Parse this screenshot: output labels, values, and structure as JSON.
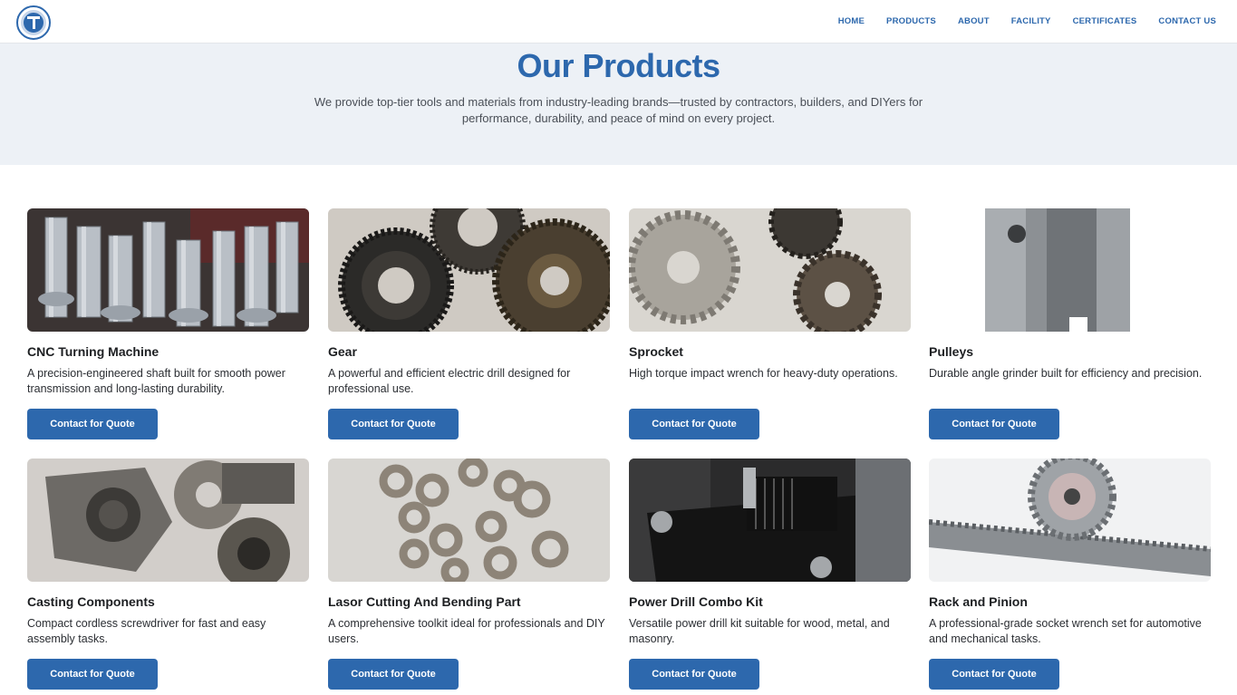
{
  "nav": {
    "items": [
      "HOME",
      "PRODUCTS",
      "ABOUT",
      "FACILITY",
      "CERTIFICATES",
      "CONTACT US"
    ]
  },
  "hero": {
    "title": "Our Products",
    "subtitle": "We provide top-tier tools and materials from industry-leading brands—trusted by contractors, builders, and DIYers for performance, durability, and peace of mind on every project."
  },
  "products": [
    {
      "name": "CNC Turning Machine",
      "description": "A precision-engineered shaft built for smooth power transmission and long-lasting durability.",
      "button": "Contact for Quote"
    },
    {
      "name": "Gear",
      "description": "A powerful and efficient electric drill designed for professional use.",
      "button": "Contact for Quote"
    },
    {
      "name": "Sprocket",
      "description": "High torque impact wrench for heavy-duty operations.",
      "button": "Contact for Quote"
    },
    {
      "name": "Pulleys",
      "description": "Durable angle grinder built for efficiency and precision.",
      "button": "Contact for Quote"
    },
    {
      "name": "Casting Components",
      "description": "Compact cordless screwdriver for fast and easy assembly tasks.",
      "button": "Contact for Quote"
    },
    {
      "name": "Lasor Cutting And Bending Part",
      "description": "A comprehensive toolkit ideal for professionals and DIY users.",
      "button": "Contact for Quote"
    },
    {
      "name": "Power Drill Combo Kit",
      "description": "Versatile power drill kit suitable for wood, metal, and masonry.",
      "button": "Contact for Quote"
    },
    {
      "name": "Rack and Pinion",
      "description": "A professional-grade socket wrench set for automotive and mechanical tasks.",
      "button": "Contact for Quote"
    }
  ],
  "colors": {
    "brand": "#2d68ad",
    "hero_bg": "#edf1f6"
  }
}
